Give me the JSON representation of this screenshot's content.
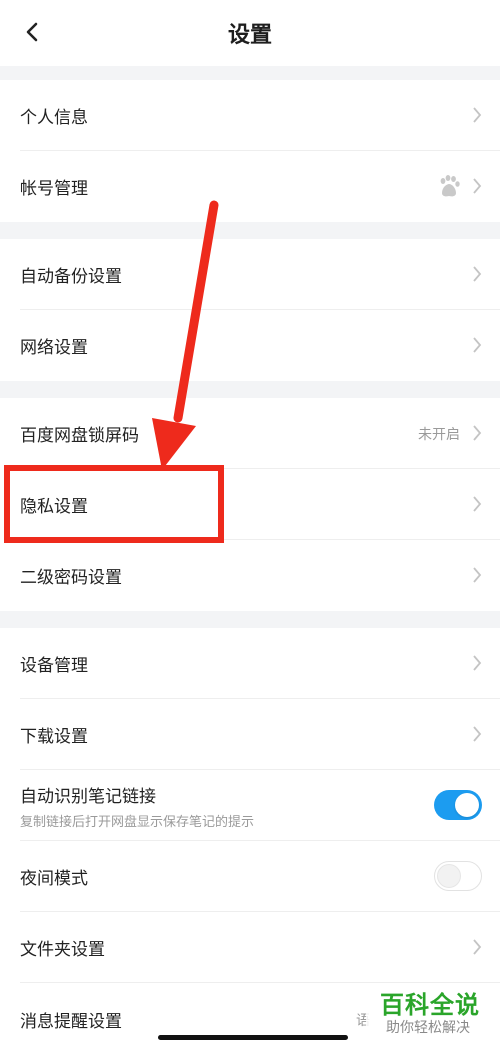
{
  "header": {
    "title": "设置"
  },
  "sections": [
    {
      "items": [
        {
          "label": "个人信息"
        },
        {
          "label": "帐号管理",
          "icon": "baidu-paw-icon"
        }
      ]
    },
    {
      "items": [
        {
          "label": "自动备份设置"
        },
        {
          "label": "网络设置"
        }
      ]
    },
    {
      "items": [
        {
          "label": "百度网盘锁屏码",
          "value": "未开启"
        },
        {
          "label": "隐私设置"
        },
        {
          "label": "二级密码设置"
        }
      ]
    },
    {
      "items": [
        {
          "label": "设备管理"
        },
        {
          "label": "下载设置"
        },
        {
          "label": "自动识别笔记链接",
          "sub": "复制链接后打开网盘显示保存笔记的提示",
          "toggle": "on"
        },
        {
          "label": "夜间模式",
          "toggle": "off"
        },
        {
          "label": "文件夹设置"
        },
        {
          "label": "消息提醒设置",
          "value": "语"
        }
      ]
    }
  ],
  "annotation": {
    "color": "#ee2a1c"
  },
  "watermark": {
    "title": "百科全说",
    "subtitle": "助你轻松解决"
  },
  "colors": {
    "toggle_on": "#1c9cf0",
    "section_gap": "#f3f4f6",
    "watermark_green": "#2aa52a"
  }
}
